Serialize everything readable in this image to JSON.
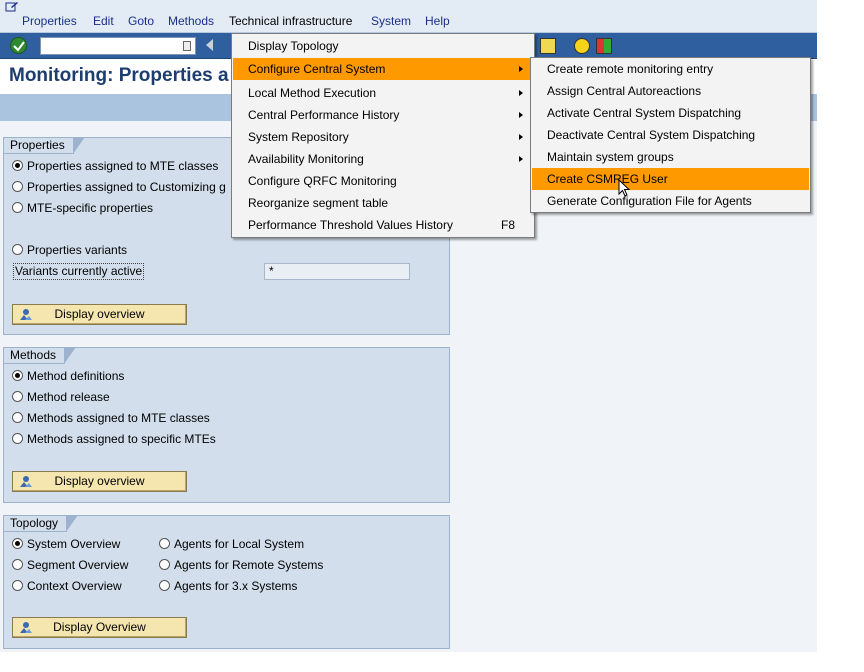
{
  "menubar": {
    "items": [
      "Properties",
      "Edit",
      "Goto",
      "Methods",
      "Technical infrastructure",
      "System",
      "Help"
    ]
  },
  "page": {
    "title": "Monitoring: Properties a"
  },
  "properties_group": {
    "title": "Properties",
    "options": [
      "Properties assigned to MTE classes",
      "Properties assigned to Customizing g",
      "MTE-specific properties",
      "Properties variants"
    ],
    "selected": "Properties assigned to MTE classes",
    "variants_label": "Variants currently active",
    "variants_value": "*",
    "button": "Display overview"
  },
  "methods_group": {
    "title": "Methods",
    "options": [
      "Method definitions",
      "Method release",
      "Methods assigned to MTE classes",
      "Methods assigned to specific MTEs"
    ],
    "selected": "Method definitions",
    "button": "Display overview"
  },
  "topology_group": {
    "title": "Topology",
    "options_left": [
      "System Overview",
      "Segment Overview",
      "Context Overview"
    ],
    "options_right": [
      "Agents for Local System",
      "Agents for Remote Systems",
      "Agents for 3.x Systems"
    ],
    "selected": "System Overview",
    "button": "Display Overview"
  },
  "tech_menu": {
    "items": [
      {
        "label": "Display Topology",
        "submenu": false,
        "shortcut": ""
      },
      {
        "label": "Configure Central System",
        "submenu": true,
        "shortcut": "",
        "highlighted": true
      },
      {
        "label": "Local Method Execution",
        "submenu": true,
        "shortcut": ""
      },
      {
        "label": "Central Performance History",
        "submenu": true,
        "shortcut": ""
      },
      {
        "label": "System Repository",
        "submenu": true,
        "shortcut": ""
      },
      {
        "label": "Availability Monitoring",
        "submenu": true,
        "shortcut": ""
      },
      {
        "label": "Configure QRFC Monitoring",
        "submenu": false,
        "shortcut": ""
      },
      {
        "label": "Reorganize segment table",
        "submenu": false,
        "shortcut": ""
      },
      {
        "label": "Performance Threshold Values History",
        "submenu": false,
        "shortcut": "F8"
      }
    ]
  },
  "sub_menu": {
    "items": [
      {
        "label": "Create remote monitoring entry"
      },
      {
        "label": "Assign Central Autoreactions"
      },
      {
        "label": "Activate Central System Dispatching"
      },
      {
        "label": "Deactivate Central System Dispatching"
      },
      {
        "label": "Maintain system groups"
      },
      {
        "label": "Create CSMREG User",
        "highlighted": true
      },
      {
        "label": "Generate Configuration File for Agents"
      }
    ]
  },
  "colors": {
    "highlight": "#ff9900",
    "group_bg": "#d2deeb",
    "toolbar": "#2f5f9e",
    "button_bg": "#f5e6b0"
  }
}
